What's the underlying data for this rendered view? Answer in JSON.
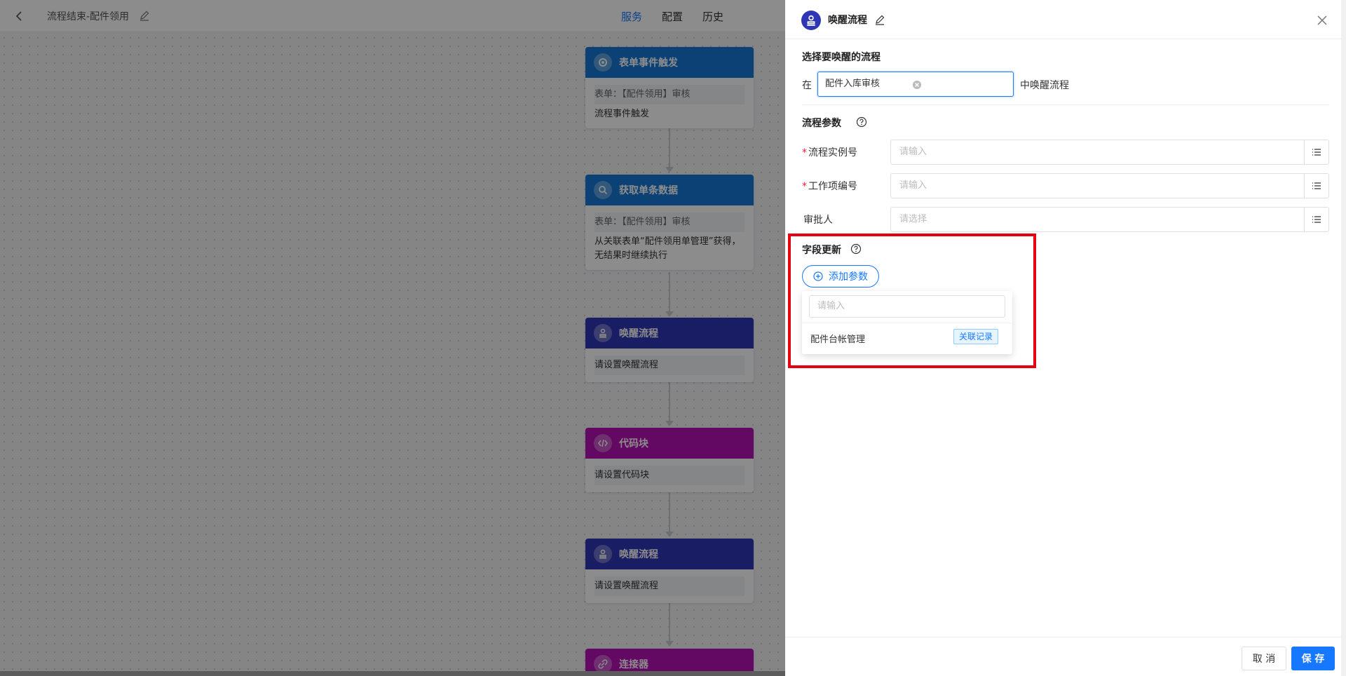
{
  "topbar": {
    "title": "流程结束-配件领用",
    "tabs": [
      "服务",
      "配置",
      "历史"
    ]
  },
  "nodes": {
    "n1": {
      "title": "表单事件触发",
      "lines": [
        "表单：【配件领用】审核"
      ],
      "plain": "流程事件触发"
    },
    "n2": {
      "title": "获取单条数据",
      "lines": [
        "表单：【配件领用】审核"
      ],
      "plain": "从关联表单“配件领用单管理”获得，无结果时继续执行"
    },
    "n3": {
      "title": "唤醒流程",
      "lines": [
        "请设置唤醒流程"
      ]
    },
    "n4": {
      "title": "代码块",
      "lines": [
        "请设置代码块"
      ]
    },
    "n5": {
      "title": "唤醒流程",
      "lines": [
        "请设置唤醒流程"
      ]
    },
    "n6": {
      "title": "连接器"
    }
  },
  "drawer": {
    "title": "唤醒流程",
    "select_section_title": "选择要唤醒的流程",
    "prefix": "在",
    "selected_flow": "配件入库审核",
    "suffix": "中唤醒流程",
    "params_title": "流程参数",
    "params": [
      {
        "label": "流程实例号",
        "required": "*",
        "placeholder": "请输入"
      },
      {
        "label": "工作项编号",
        "required": "*",
        "placeholder": "请输入"
      },
      {
        "label": "审批人",
        "required": "",
        "placeholder": "请选择"
      }
    ],
    "fields_title": "字段更新",
    "add_param_label": "添加参数",
    "dropdown": {
      "search_placeholder": "请输入",
      "item_label": "配件台帐管理",
      "item_tag": "关联记录"
    },
    "cancel_label": "取 消",
    "save_label": "保 存"
  },
  "colors": {
    "accent": "#1677ff",
    "node_blue": "#1677d6",
    "node_indigo": "#2f36b5",
    "node_purple": "#b510b5",
    "highlight": "#e60012"
  }
}
